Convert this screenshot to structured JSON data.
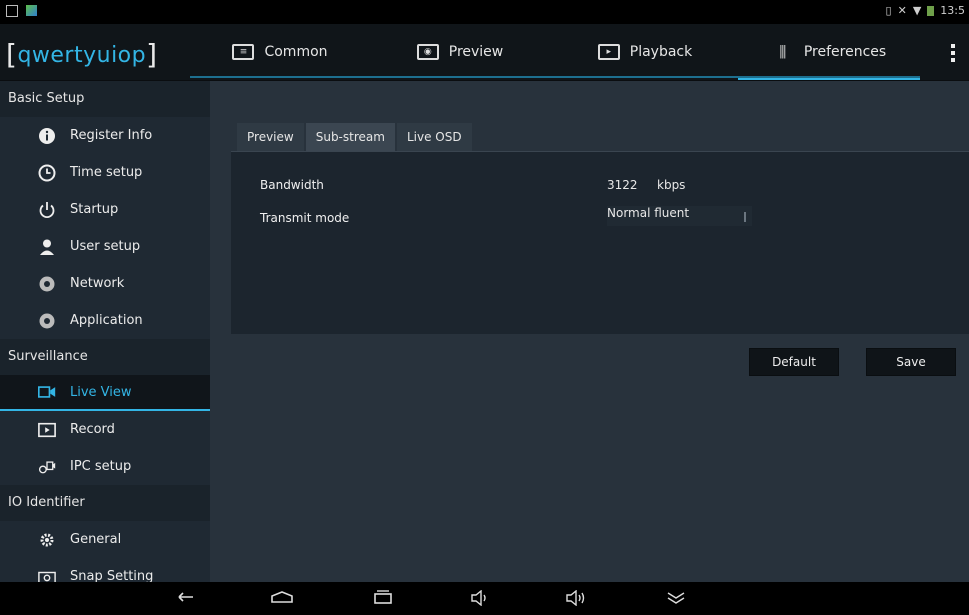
{
  "status_bar": {
    "time": "13:5"
  },
  "header": {
    "app_title": "qwertyuiop",
    "tabs": [
      {
        "label": "Common",
        "icon": "grid-icon"
      },
      {
        "label": "Preview",
        "icon": "eye-icon"
      },
      {
        "label": "Playback",
        "icon": "film-icon"
      },
      {
        "label": "Preferences",
        "icon": "sliders-icon"
      }
    ],
    "active_tab": "Preferences"
  },
  "sidebar": {
    "sections": [
      {
        "title": "Basic Setup",
        "items": [
          "Register Info",
          "Time setup",
          "Startup",
          "User setup",
          "Network",
          "Application"
        ]
      },
      {
        "title": "Surveillance",
        "items": [
          "Live View",
          "Record",
          "IPC setup"
        ]
      },
      {
        "title": "IO Identifier",
        "items": [
          "General",
          "Snap Setting"
        ]
      }
    ],
    "selected_item": "Live View"
  },
  "main": {
    "subtabs": [
      "Preview",
      "Sub-stream",
      "Live OSD"
    ],
    "active_subtab": "Sub-stream",
    "fields": {
      "bandwidth_label": "Bandwidth",
      "bandwidth_value": "3122",
      "bandwidth_unit": "kbps",
      "transmit_label": "Transmit mode",
      "transmit_value": "Normal fluent"
    },
    "buttons": {
      "default": "Default",
      "save": "Save"
    }
  },
  "colors": {
    "accent": "#33b5e5",
    "background": "#28323c",
    "sidebar": "#1f2933"
  }
}
